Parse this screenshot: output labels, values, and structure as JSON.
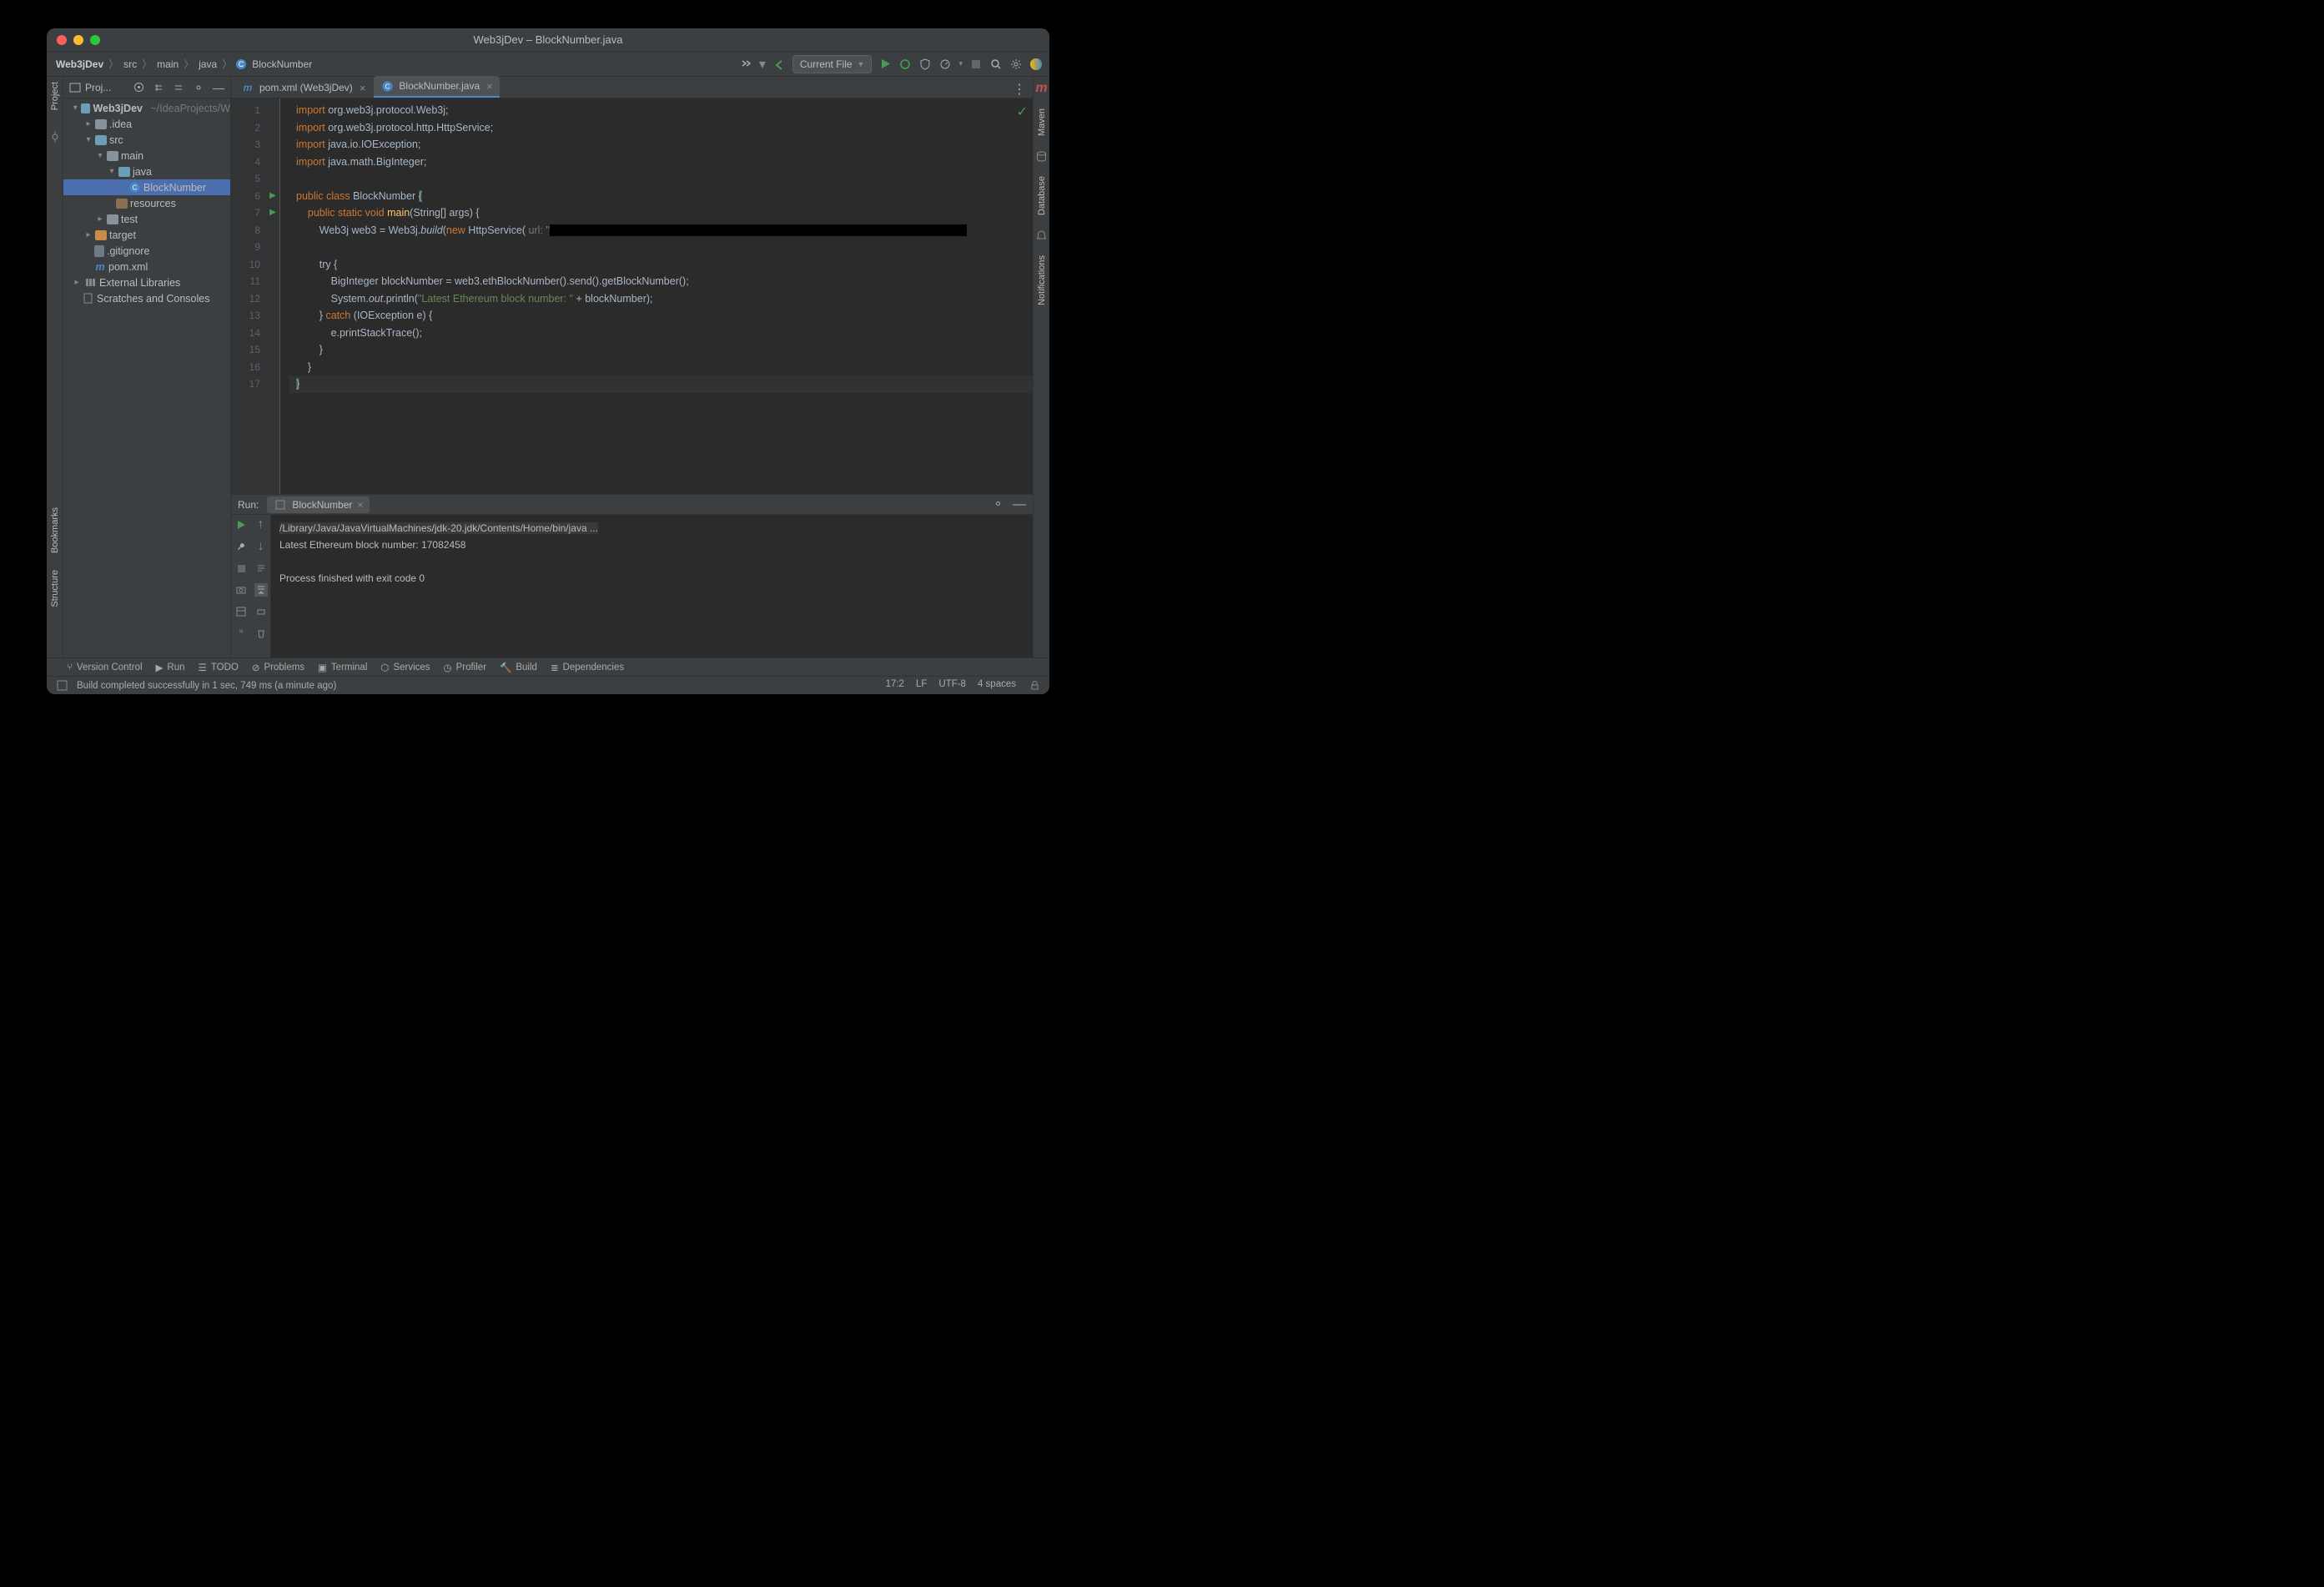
{
  "title": "Web3jDev – BlockNumber.java",
  "breadcrumbs": [
    "Web3jDev",
    "src",
    "main",
    "java",
    "BlockNumber"
  ],
  "run_config": "Current File",
  "project_panel_label": "Proj...",
  "tree": {
    "root": "Web3jDev",
    "root_path": "~/IdeaProjects/W",
    "idea": ".idea",
    "src": "src",
    "main": "main",
    "java": "java",
    "blocknumber": "BlockNumber",
    "resources": "resources",
    "test": "test",
    "target": "target",
    "gitignore": ".gitignore",
    "pom": "pom.xml",
    "ext": "External Libraries",
    "scratch": "Scratches and Consoles"
  },
  "tabs": {
    "pom": "pom.xml (Web3jDev)",
    "block": "BlockNumber.java"
  },
  "code": {
    "l1a": "import",
    "l1b": " org.web3j.protocol.Web3j;",
    "l2a": "import",
    "l2b": " org.web3j.protocol.http.HttpService;",
    "l3a": "import",
    "l3b": " java.io.IOException;",
    "l4a": "import",
    "l4b": " java.math.BigInteger;",
    "l6a": "public class ",
    "l6b": "BlockNumber ",
    "l6c": "{",
    "l7a": "    public static void ",
    "l7b": "main",
    "l7c": "(String[] args) {",
    "l8a": "        Web3j web3 = Web3j.",
    "l8b": "build",
    "l8c": "(",
    "l8d": "new",
    "l8e": " HttpService(",
    "l8hint": " url: ",
    "l8f": "\"",
    "l10": "        try {",
    "l11": "            BigInteger blockNumber = web3.ethBlockNumber().send().getBlockNumber();",
    "l12a": "            System.",
    "l12b": "out",
    "l12c": ".println(",
    "l12d": "\"Latest Ethereum block number: \"",
    "l12e": " + blockNumber);",
    "l13a": "        } ",
    "l13b": "catch",
    "l13c": " (IOException e) {",
    "l14": "            e.printStackTrace();",
    "l15": "        }",
    "l16": "    }",
    "l17": "}"
  },
  "line_numbers": [
    "1",
    "2",
    "3",
    "4",
    "5",
    "6",
    "7",
    "8",
    "9",
    "10",
    "11",
    "12",
    "13",
    "14",
    "15",
    "16",
    "17"
  ],
  "run": {
    "label": "Run:",
    "tab": "BlockNumber",
    "cmd": "/Library/Java/JavaVirtualMachines/jdk-20.jdk/Contents/Home/bin/java ...",
    "out": "Latest Ethereum block number: 17082458",
    "exit": "Process finished with exit code 0"
  },
  "bottom_tabs": {
    "vcs": "Version Control",
    "run": "Run",
    "todo": "TODO",
    "problems": "Problems",
    "terminal": "Terminal",
    "services": "Services",
    "profiler": "Profiler",
    "build": "Build",
    "deps": "Dependencies"
  },
  "status": {
    "msg": "Build completed successfully in 1 sec, 749 ms (a minute ago)",
    "pos": "17:2",
    "sep": "LF",
    "enc": "UTF-8",
    "indent": "4 spaces"
  },
  "right_rail": {
    "maven": "Maven",
    "database": "Database",
    "notif": "Notifications"
  },
  "left_rail": {
    "project": "Project",
    "bookmarks": "Bookmarks",
    "structure": "Structure"
  }
}
